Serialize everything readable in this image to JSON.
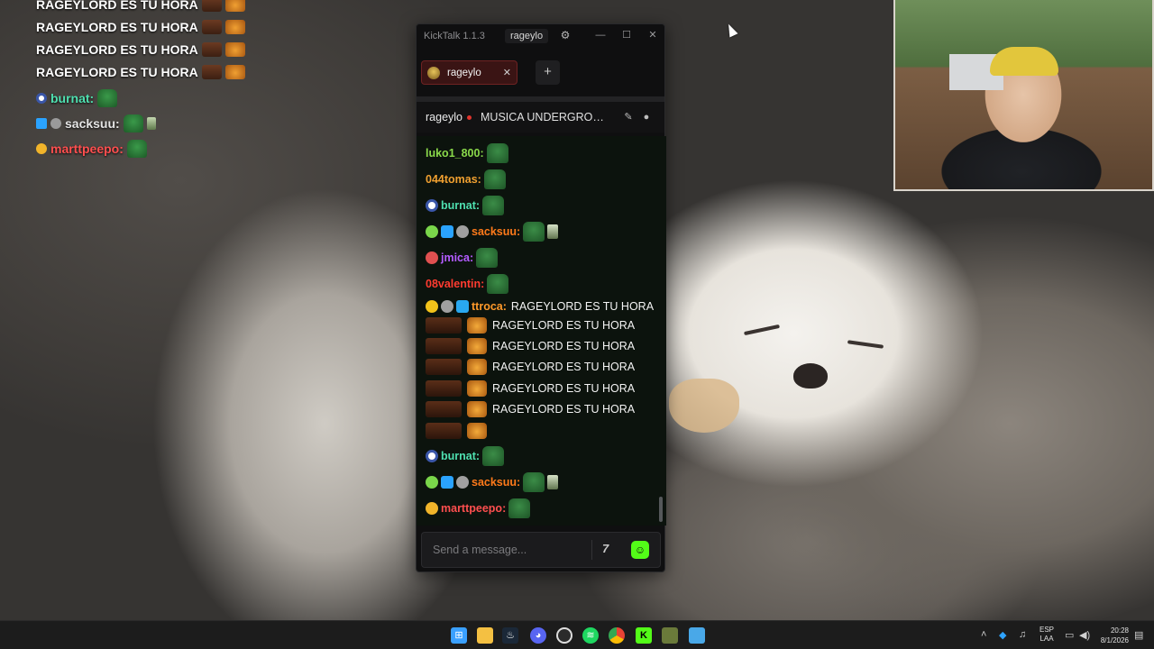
{
  "overlay": {
    "spam_rows": [
      "RAGEYLORD ES TU HORA",
      "RAGEYLORD ES TU HORA",
      "RAGEYLORD ES TU HORA"
    ],
    "messages": [
      {
        "name": "burnat:",
        "color": "#4fe0b0"
      },
      {
        "name": "sacksuu:",
        "color": "#e5e5e5"
      },
      {
        "name": "marttpeepo:",
        "color": "#ff4f4f"
      }
    ]
  },
  "window": {
    "app_title": "KickTalk 1.1.3",
    "user": "rageylo",
    "settings_icon": "gear-icon",
    "minimize_icon": "minimize-icon",
    "maximize_icon": "maximize-icon",
    "close_icon": "close-icon"
  },
  "tabs": [
    {
      "label": "rageylo",
      "close_icon": "close-icon"
    }
  ],
  "add_tab_label": "+",
  "channel": {
    "name": "rageylo",
    "stream_title": "MUSICA UNDERGROU...",
    "live": true
  },
  "chat": {
    "messages": [
      {
        "name": "luko1_800:",
        "color": "#8ad94a"
      },
      {
        "name": "044tomas:",
        "color": "#f0a030"
      },
      {
        "name": "burnat:",
        "color": "#4fe0b0"
      },
      {
        "name": "sacksuu:",
        "color": "#ff7a1a"
      },
      {
        "name": "jmica:",
        "color": "#b45cff"
      },
      {
        "name": "08valentin:",
        "color": "#ff3b30"
      },
      {
        "name": "ttroca:",
        "color": "#ff9a2a",
        "text": "RAGEYLORD ES TU HORA"
      }
    ],
    "spam": [
      "RAGEYLORD ES TU HORA",
      "RAGEYLORD ES TU HORA",
      "RAGEYLORD ES TU HORA",
      "RAGEYLORD ES TU HORA",
      "RAGEYLORD ES TU HORA",
      ""
    ],
    "after": [
      {
        "name": "burnat:",
        "color": "#4fe0b0"
      },
      {
        "name": "sacksuu:",
        "color": "#ff7a1a"
      },
      {
        "name": "marttpeepo:",
        "color": "#ff4f4f"
      }
    ]
  },
  "input": {
    "placeholder": "Send a message...",
    "seventv_label": "7",
    "emote_icon": "kick-emote-icon"
  },
  "taskbar": {
    "lang_top": "ESP",
    "lang_bottom": "LAA",
    "time": "20:28",
    "date": "8/1/2026",
    "apps": [
      "windows-start-icon",
      "file-explorer-icon",
      "steam-icon",
      "discord-icon",
      "obs-icon",
      "spotify-icon",
      "chrome-icon",
      "kick-icon",
      "game-icon",
      "notepad-icon"
    ]
  },
  "colors": {
    "kick_green": "#53fc18",
    "tab_red": "#6e2222"
  }
}
